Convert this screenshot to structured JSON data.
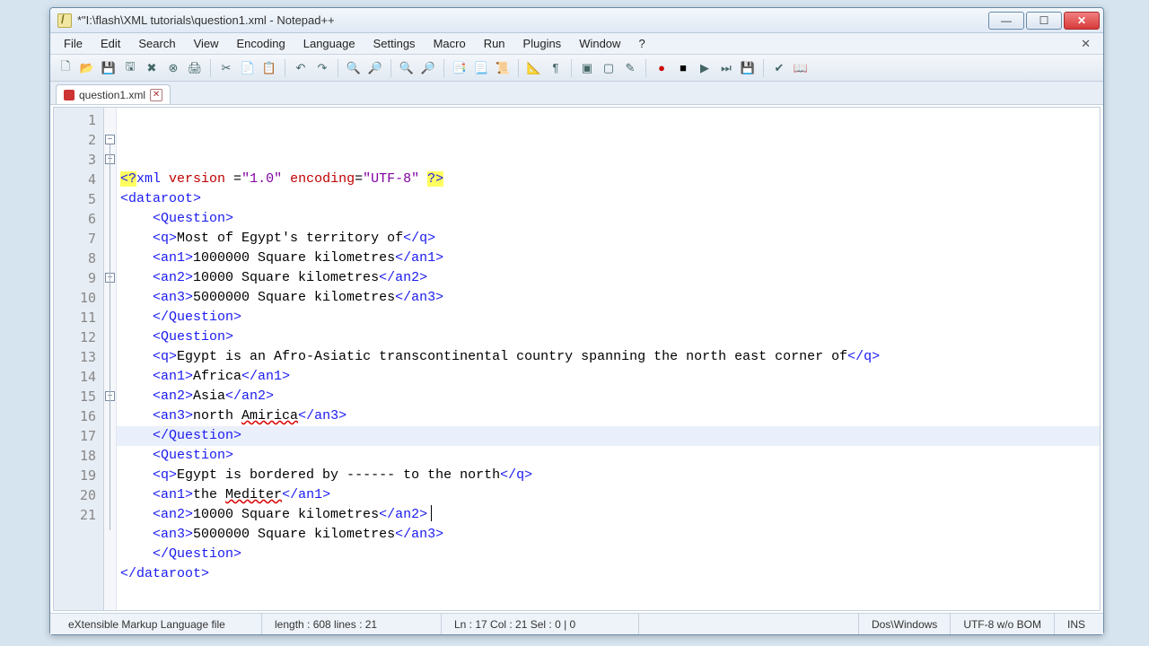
{
  "title": "*\"I:\\flash\\XML tutorials\\question1.xml - Notepad++",
  "menus": [
    "File",
    "Edit",
    "Search",
    "View",
    "Encoding",
    "Language",
    "Settings",
    "Macro",
    "Run",
    "Plugins",
    "Window",
    "?"
  ],
  "tab": {
    "label": "question1.xml"
  },
  "toolbar_icons": [
    "new",
    "open",
    "save",
    "save-all",
    "close",
    "close-all",
    "print",
    "|",
    "cut",
    "copy",
    "paste",
    "|",
    "undo",
    "redo",
    "|",
    "find",
    "replace",
    "|",
    "zoom-in",
    "zoom-out",
    "|",
    "ww1",
    "ww2",
    "ww3",
    "|",
    "guide",
    "indent",
    "|",
    "fold",
    "unfold",
    "highlight",
    "|",
    "rec",
    "stop",
    "play",
    "play2",
    "save-macro",
    "|",
    "spell",
    "book"
  ],
  "icon_glyphs": {
    "new": "🗋",
    "open": "📂",
    "save": "💾",
    "save-all": "🖫",
    "close": "✖",
    "close-all": "⊗",
    "print": "🖨",
    "cut": "✂",
    "copy": "📄",
    "paste": "📋",
    "undo": "↶",
    "redo": "↷",
    "find": "🔍",
    "replace": "🔎",
    "zoom-in": "🔍",
    "zoom-out": "🔎",
    "ww1": "📑",
    "ww2": "📃",
    "ww3": "📜",
    "guide": "📐",
    "indent": "¶",
    "fold": "▣",
    "unfold": "▢",
    "highlight": "✎",
    "rec": "●",
    "stop": "■",
    "play": "▶",
    "play2": "⏭",
    "save-macro": "💾",
    "spell": "✔",
    "book": "📖"
  },
  "lines": [
    {
      "n": 1,
      "indent": 0,
      "parts": [
        {
          "c": "t-yellow t-blue",
          "t": "<?"
        },
        {
          "c": "t-blue",
          "t": "xml "
        },
        {
          "c": "t-attr",
          "t": "version "
        },
        {
          "c": "",
          "t": "="
        },
        {
          "c": "t-purple",
          "t": "\"1.0\" "
        },
        {
          "c": "t-attr",
          "t": "encoding"
        },
        {
          "c": "",
          "t": "="
        },
        {
          "c": "t-purple",
          "t": "\"UTF-8\" "
        },
        {
          "c": "t-yellow t-blue",
          "t": "?>"
        }
      ]
    },
    {
      "n": 2,
      "indent": 0,
      "fold": "-",
      "parts": [
        {
          "c": "t-blue",
          "t": "<dataroot>"
        }
      ]
    },
    {
      "n": 3,
      "indent": 1,
      "fold": "-",
      "parts": [
        {
          "c": "t-blue",
          "t": "<Question>"
        }
      ]
    },
    {
      "n": 4,
      "indent": 1,
      "parts": [
        {
          "c": "t-blue",
          "t": "<q>"
        },
        {
          "c": "",
          "t": "Most of Egypt's territory of"
        },
        {
          "c": "t-blue",
          "t": "</q>"
        }
      ]
    },
    {
      "n": 5,
      "indent": 1,
      "parts": [
        {
          "c": "t-blue",
          "t": "<an1>"
        },
        {
          "c": "",
          "t": "1000000 Square kilometres"
        },
        {
          "c": "t-blue",
          "t": "</an1>"
        }
      ]
    },
    {
      "n": 6,
      "indent": 1,
      "parts": [
        {
          "c": "t-blue",
          "t": "<an2>"
        },
        {
          "c": "",
          "t": "10000 Square kilometres"
        },
        {
          "c": "t-blue",
          "t": "</an2>"
        }
      ]
    },
    {
      "n": 7,
      "indent": 1,
      "parts": [
        {
          "c": "t-blue",
          "t": "<an3>"
        },
        {
          "c": "",
          "t": "5000000 Square kilometres"
        },
        {
          "c": "t-blue",
          "t": "</an3>"
        }
      ]
    },
    {
      "n": 8,
      "indent": 1,
      "parts": [
        {
          "c": "t-blue",
          "t": "</Question>"
        }
      ]
    },
    {
      "n": 9,
      "indent": 1,
      "fold": "-",
      "parts": [
        {
          "c": "t-blue",
          "t": "<Question>"
        }
      ]
    },
    {
      "n": 10,
      "indent": 1,
      "parts": [
        {
          "c": "t-blue",
          "t": "<q>"
        },
        {
          "c": "",
          "t": "Egypt is an Afro-Asiatic transcontinental country spanning the north east corner of"
        },
        {
          "c": "t-blue",
          "t": "</q>"
        }
      ]
    },
    {
      "n": 11,
      "indent": 1,
      "parts": [
        {
          "c": "t-blue",
          "t": "<an1>"
        },
        {
          "c": "",
          "t": "Africa"
        },
        {
          "c": "t-blue",
          "t": "</an1>"
        }
      ]
    },
    {
      "n": 12,
      "indent": 1,
      "parts": [
        {
          "c": "t-blue",
          "t": "<an2>"
        },
        {
          "c": "",
          "t": "Asia"
        },
        {
          "c": "t-blue",
          "t": "</an2>"
        }
      ]
    },
    {
      "n": 13,
      "indent": 1,
      "parts": [
        {
          "c": "t-blue",
          "t": "<an3>"
        },
        {
          "c": "",
          "t": "north "
        },
        {
          "c": "t-red-u",
          "t": "Amirica"
        },
        {
          "c": "t-blue",
          "t": "</an3>"
        }
      ]
    },
    {
      "n": 14,
      "indent": 1,
      "parts": [
        {
          "c": "t-blue",
          "t": "</Question>"
        }
      ]
    },
    {
      "n": 15,
      "indent": 1,
      "fold": "-",
      "parts": [
        {
          "c": "t-blue",
          "t": "<Question>"
        }
      ]
    },
    {
      "n": 16,
      "indent": 1,
      "parts": [
        {
          "c": "t-blue",
          "t": "<q>"
        },
        {
          "c": "",
          "t": "Egypt is bordered by ------ to the north"
        },
        {
          "c": "t-blue",
          "t": "</q>"
        }
      ]
    },
    {
      "n": 17,
      "indent": 1,
      "hl": true,
      "parts": [
        {
          "c": "t-blue",
          "t": "<an1>"
        },
        {
          "c": "",
          "t": "the "
        },
        {
          "c": "t-red-u",
          "t": "Mediter"
        },
        {
          "c": "t-blue",
          "t": "</an1>"
        }
      ]
    },
    {
      "n": 18,
      "indent": 1,
      "parts": [
        {
          "c": "t-blue",
          "t": "<an2>"
        },
        {
          "c": "",
          "t": "10000 Square kilometres"
        },
        {
          "c": "t-blue",
          "t": "</an2>"
        }
      ]
    },
    {
      "n": 19,
      "indent": 1,
      "parts": [
        {
          "c": "t-blue",
          "t": "<an3>"
        },
        {
          "c": "",
          "t": "5000000 Square kilometres"
        },
        {
          "c": "t-blue",
          "t": "</an3>"
        }
      ]
    },
    {
      "n": 20,
      "indent": 1,
      "parts": [
        {
          "c": "t-blue",
          "t": "</Question>"
        }
      ]
    },
    {
      "n": 21,
      "indent": 0,
      "parts": [
        {
          "c": "t-blue",
          "t": "</dataroot>"
        }
      ]
    }
  ],
  "status": {
    "type": "eXtensible Markup Language file",
    "length": "length : 608    lines : 21",
    "pos": "Ln : 17    Col : 21    Sel : 0 | 0",
    "eol": "Dos\\Windows",
    "enc": "UTF-8 w/o BOM",
    "mode": "INS"
  }
}
